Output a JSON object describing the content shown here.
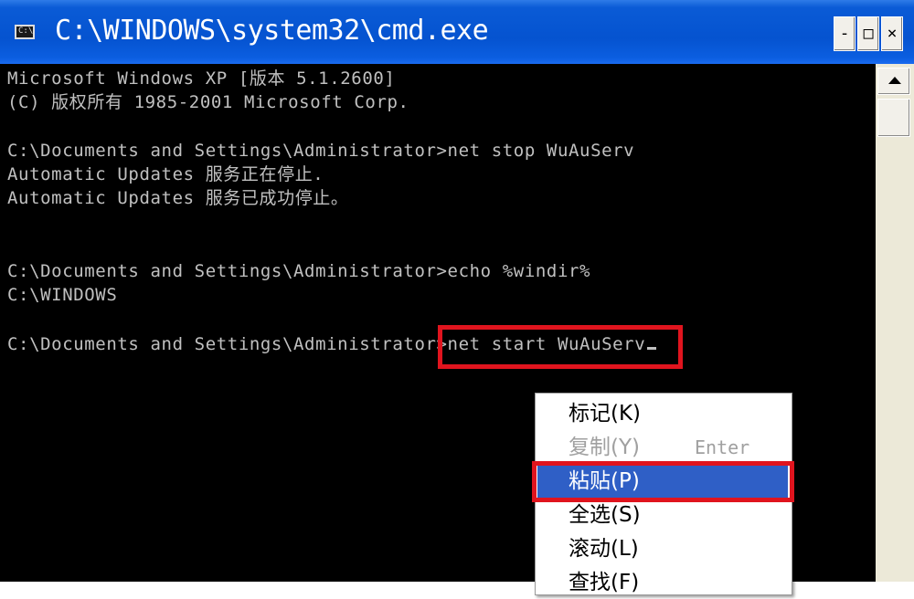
{
  "window": {
    "title": "C:\\WINDOWS\\system32\\cmd.exe",
    "icon_label": "C:\\",
    "controls": {
      "minimize": "-",
      "maximize": "□",
      "close": "×"
    }
  },
  "console": {
    "lines": [
      "Microsoft Windows XP [版本 5.1.2600]",
      "(C) 版权所有 1985-2001 Microsoft Corp.",
      "",
      "C:\\Documents and Settings\\Administrator>net stop WuAuServ",
      "Automatic Updates 服务正在停止.",
      "Automatic Updates 服务已成功停止。",
      "",
      "",
      "C:\\Documents and Settings\\Administrator>echo %windir%",
      "C:\\WINDOWS",
      "",
      "C:\\Documents and Settings\\Administrator>net start WuAuServ"
    ]
  },
  "context_menu": {
    "items": [
      {
        "label": "标记(K)",
        "state": "normal"
      },
      {
        "label": "复制(Y)",
        "state": "disabled",
        "shortcut": "Enter"
      },
      {
        "label": "粘贴(P)",
        "state": "selected"
      },
      {
        "label": "全选(S)",
        "state": "normal"
      },
      {
        "label": "滚动(L)",
        "state": "normal"
      },
      {
        "label": "查找(F)",
        "state": "normal"
      }
    ]
  },
  "colors": {
    "titlebar": "#0553d0",
    "console_bg": "#000000",
    "console_text": "#c0c0c0",
    "highlight": "#e0141e",
    "menu_selected": "#2f5fc6"
  }
}
